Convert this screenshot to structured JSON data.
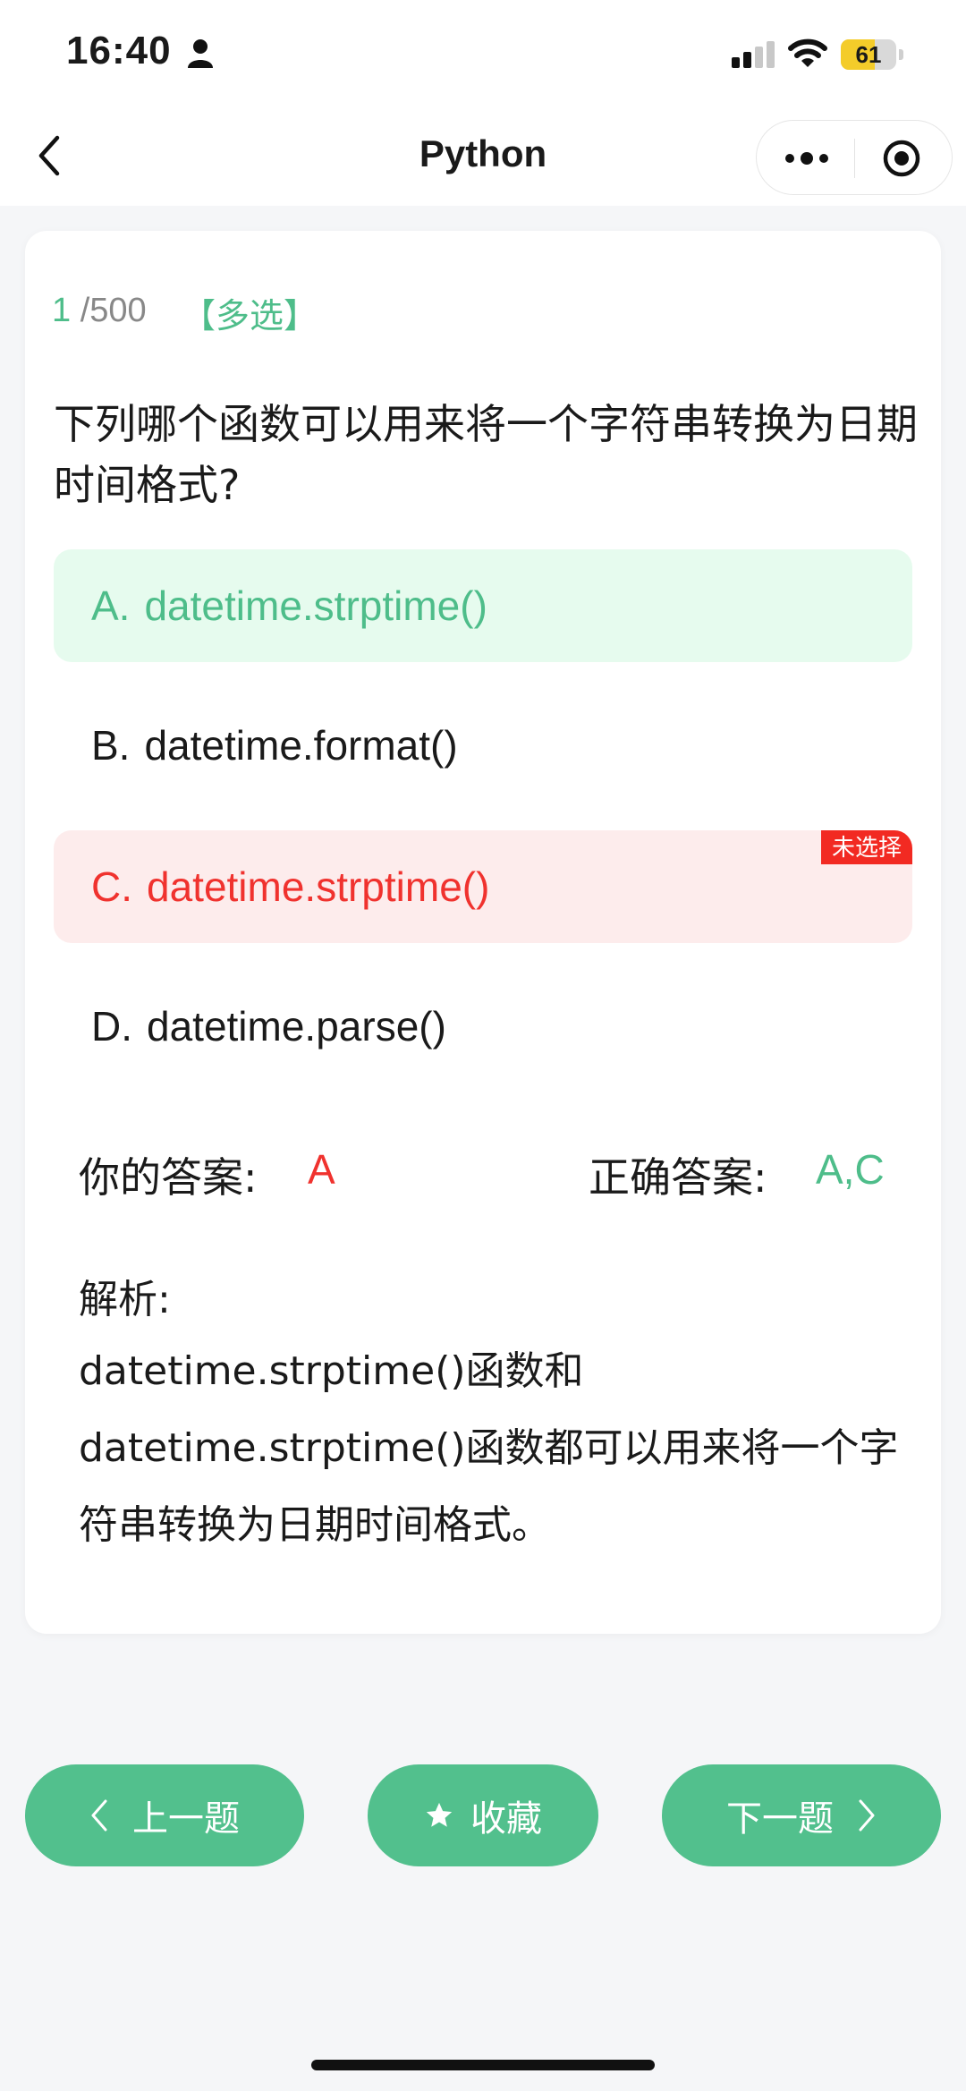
{
  "status_bar": {
    "time": "16:40",
    "battery_level": "61",
    "battery_fraction": 0.61,
    "battery_color": "#f4cc2a",
    "icons": [
      "person-icon",
      "signal-icon",
      "wifi-icon",
      "battery-icon"
    ]
  },
  "nav": {
    "title": "Python",
    "icons": [
      "back-icon",
      "more-icon",
      "target-icon"
    ]
  },
  "question": {
    "current": "1",
    "total": "/500",
    "type": "【多选】",
    "text": "下列哪个函数可以用来将一个字符串转换为日期时间格式?",
    "options": [
      {
        "letter": "A.",
        "text": "datetime.strptime()",
        "state": "correct-selected"
      },
      {
        "letter": "B.",
        "text": "datetime.format()",
        "state": "normal"
      },
      {
        "letter": "C.",
        "text": "datetime.strptime()",
        "state": "missed",
        "tag": "未选择"
      },
      {
        "letter": "D.",
        "text": "datetime.parse()",
        "state": "normal"
      }
    ]
  },
  "answers": {
    "your_label": "你的答案:",
    "your_value": "A",
    "correct_label": "正确答案:",
    "correct_value": "A,C"
  },
  "analysis": {
    "title": "解析:",
    "body": "datetime.strptime()函数和datetime.strptime()函数都可以用来将一个字符串转换为日期时间格式。"
  },
  "buttons": {
    "prev": "上一题",
    "favorite": "收藏",
    "next": "下一题"
  },
  "colors": {
    "accent_green": "#52c08d",
    "text_green": "#4ebd8a",
    "error_red": "#f0322e",
    "correct_bg": "#e6fbee",
    "error_bg": "#fdecec"
  }
}
